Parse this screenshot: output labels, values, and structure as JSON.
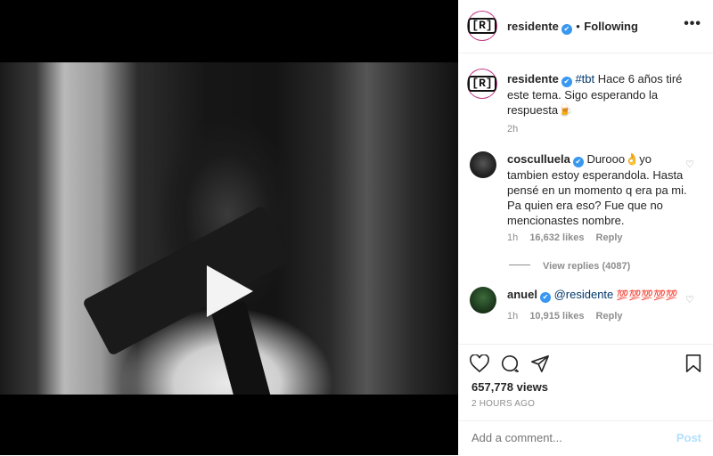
{
  "post": {
    "username": "residente",
    "following_label": "Following",
    "separator": "•",
    "more_label": "•••",
    "avatar_text": "[R]"
  },
  "caption": {
    "username": "residente",
    "hashtag": "#tbt",
    "text": " Hace 6 años tiré este tema. Sigo esperando la respuesta🍺",
    "time": "2h"
  },
  "comments": [
    {
      "username": "cosculluela",
      "text": "Durooo👌yo tambien estoy esperandola. Hasta pensé en un momento q era pa mi. Pa quien era eso? Fue que no mencionastes nombre.",
      "time": "1h",
      "likes": "16,632 likes",
      "reply": "Reply",
      "view_replies": "View replies (4087)"
    },
    {
      "username": "anuel",
      "mention": "@residente",
      "emoji": "💯💯💯💯💯",
      "time": "1h",
      "likes": "10,915 likes",
      "reply": "Reply"
    }
  ],
  "stats": {
    "views": "657,778 views",
    "ago": "2 HOURS AGO"
  },
  "add_comment": {
    "placeholder": "Add a comment...",
    "post_label": "Post"
  },
  "icons": [
    "heart-icon",
    "comment-icon",
    "share-icon",
    "bookmark-icon",
    "play-icon",
    "verified-icon"
  ],
  "colors": {
    "link": "#00376b",
    "verified": "#3897f0",
    "post_disabled": "#b2dffc",
    "muted": "#8e8e8e"
  }
}
